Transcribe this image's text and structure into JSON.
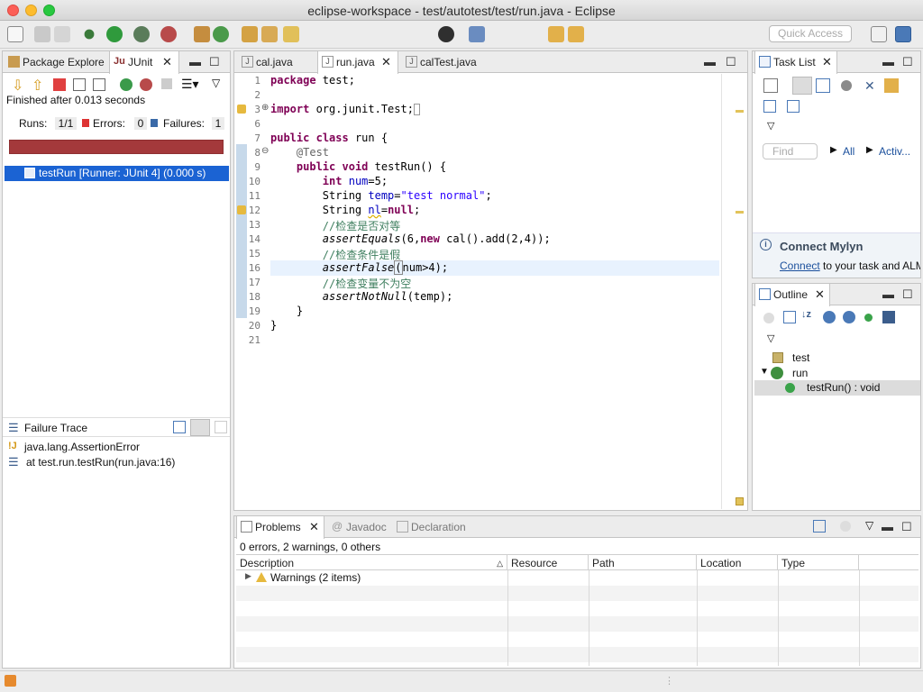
{
  "window": {
    "title": "eclipse-workspace - test/autotest/test/run.java - Eclipse"
  },
  "toolbar": {
    "quick_access_placeholder": "Quick Access"
  },
  "left_panel": {
    "tabs": [
      {
        "label": "Package Explore"
      },
      {
        "label": "JUnit"
      }
    ],
    "status": "Finished after 0.013 seconds",
    "runs_label": "Runs:",
    "runs_value": "1/1",
    "errors_label": "Errors:",
    "errors_value": "0",
    "failures_label": "Failures:",
    "failures_value": "1",
    "bar_color": "#a4393b",
    "test_item": "testRun [Runner: JUnit 4] (0.000 s)",
    "failure_trace_title": "Failure Trace",
    "trace_lines": [
      "java.lang.AssertionError",
      "at test.run.testRun(run.java:16)"
    ]
  },
  "editor": {
    "tabs": [
      {
        "label": "cal.java"
      },
      {
        "label": "run.java"
      },
      {
        "label": "calTest.java"
      }
    ],
    "line_numbers": [
      "1",
      "2",
      "3",
      "6",
      "7",
      "8",
      "9",
      "10",
      "11",
      "12",
      "13",
      "14",
      "15",
      "16",
      "17",
      "18",
      "19",
      "20",
      "21"
    ]
  },
  "task_list": {
    "title": "Task List",
    "find_placeholder": "Find",
    "all_label": "All",
    "activ_label": "Activ...",
    "connect_title": "Connect Mylyn",
    "connect_link": "Connect",
    "connect_text": " to your task and ALM"
  },
  "outline": {
    "title": "Outline",
    "items": [
      {
        "label": "test"
      },
      {
        "label": "run"
      },
      {
        "label": "testRun() : void"
      }
    ]
  },
  "bottom": {
    "tabs": [
      {
        "label": "Problems"
      },
      {
        "label": "Javadoc"
      },
      {
        "label": "Declaration"
      }
    ],
    "summary": "0 errors, 2 warnings, 0 others",
    "columns": [
      "Description",
      "Resource",
      "Path",
      "Location",
      "Type"
    ],
    "warnings_row": "Warnings (2 items)"
  }
}
